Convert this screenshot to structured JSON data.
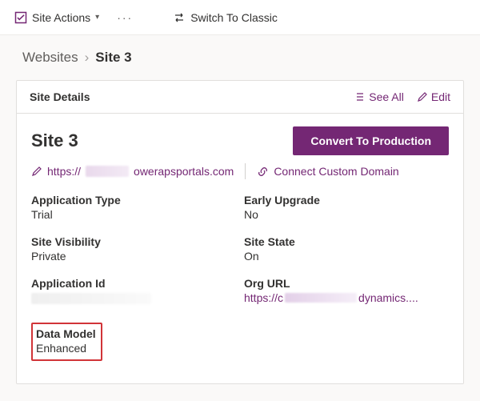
{
  "topbar": {
    "site_actions_label": "Site Actions",
    "switch_classic_label": "Switch To Classic"
  },
  "breadcrumb": {
    "root": "Websites",
    "current": "Site 3"
  },
  "card": {
    "header_title": "Site Details",
    "see_all_label": "See All",
    "edit_label": "Edit",
    "site_name": "Site 3",
    "convert_label": "Convert To Production",
    "site_url_prefix": "https://",
    "site_url_suffix": "owerapsportals.com",
    "connect_domain_label": "Connect Custom Domain",
    "fields": {
      "app_type_label": "Application Type",
      "app_type_value": "Trial",
      "early_upgrade_label": "Early Upgrade",
      "early_upgrade_value": "No",
      "site_visibility_label": "Site Visibility",
      "site_visibility_value": "Private",
      "site_state_label": "Site State",
      "site_state_value": "On",
      "app_id_label": "Application Id",
      "org_url_label": "Org URL",
      "org_url_prefix": "https://c",
      "org_url_suffix": "dynamics....",
      "data_model_label": "Data Model",
      "data_model_value": "Enhanced"
    }
  }
}
